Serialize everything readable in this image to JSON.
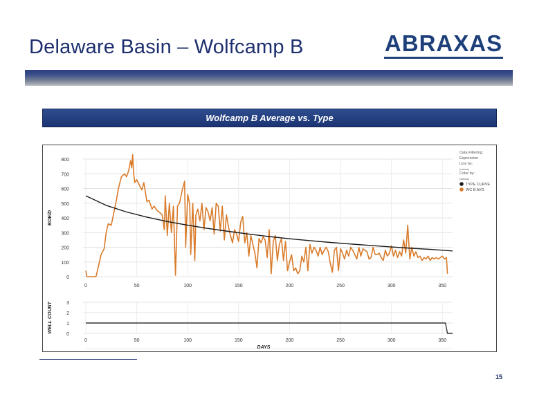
{
  "slide": {
    "title": "Delaware Basin – Wolfcamp B",
    "logo_text": "ABRAXAS",
    "page_number": "15",
    "colors": {
      "brand": "#1d2f6e",
      "band": "#2a3f7e"
    }
  },
  "chart_banner": "Wolfcamp B Average vs. Type",
  "chart_data": [
    {
      "type": "line",
      "title": "",
      "xlabel": "",
      "ylabel": "BOE/D",
      "xlim": [
        0,
        360
      ],
      "ylim": [
        0,
        800
      ],
      "x_ticks": [
        0,
        50,
        100,
        150,
        200,
        250,
        300,
        350
      ],
      "y_ticks": [
        0,
        100,
        200,
        300,
        400,
        500,
        600,
        700,
        800
      ],
      "grid": true,
      "legend": {
        "placement": "right",
        "header_lines": [
          "Data Filtering:",
          "Expression",
          "Line by:",
          "(various)",
          "Color by:",
          "(various)"
        ]
      },
      "series": [
        {
          "name": "TYPE CURVE",
          "color": "#1a1a1a",
          "x": [
            0,
            20,
            40,
            60,
            80,
            100,
            120,
            140,
            160,
            180,
            200,
            220,
            240,
            260,
            280,
            300,
            320,
            340,
            360
          ],
          "y": [
            550,
            485,
            440,
            405,
            375,
            350,
            328,
            308,
            290,
            273,
            258,
            245,
            233,
            222,
            212,
            202,
            193,
            185,
            175
          ]
        },
        {
          "name": "WC B AVG",
          "color": "#d97b2a",
          "x": [
            0,
            1,
            5,
            10,
            12,
            15,
            18,
            20,
            22,
            25,
            27,
            30,
            32,
            35,
            38,
            40,
            42,
            44,
            45,
            46,
            47,
            48,
            50,
            52,
            55,
            57,
            60,
            62,
            65,
            67,
            70,
            72,
            75,
            77,
            78,
            80,
            82,
            84,
            86,
            88,
            90,
            92,
            95,
            97,
            98,
            100,
            102,
            103,
            105,
            107,
            108,
            110,
            112,
            114,
            116,
            118,
            120,
            122,
            124,
            126,
            128,
            130,
            132,
            134,
            136,
            138,
            140,
            142,
            144,
            146,
            148,
            150,
            152,
            154,
            156,
            158,
            160,
            162,
            164,
            166,
            168,
            170,
            172,
            174,
            176,
            178,
            180,
            182,
            184,
            186,
            188,
            190,
            192,
            194,
            196,
            198,
            200,
            202,
            204,
            206,
            208,
            210,
            212,
            214,
            216,
            218,
            220,
            222,
            224,
            226,
            228,
            230,
            232,
            234,
            236,
            238,
            240,
            242,
            244,
            246,
            248,
            250,
            252,
            254,
            256,
            258,
            260,
            262,
            264,
            266,
            268,
            270,
            272,
            274,
            276,
            278,
            280,
            282,
            284,
            286,
            288,
            290,
            292,
            294,
            296,
            298,
            300,
            302,
            304,
            306,
            308,
            310,
            312,
            314,
            316,
            318,
            320,
            322,
            324,
            326,
            328,
            330,
            332,
            334,
            336,
            338,
            340,
            342,
            344,
            346,
            348,
            350,
            352,
            354,
            355
          ],
          "y": [
            40,
            0,
            0,
            0,
            60,
            150,
            190,
            300,
            360,
            350,
            420,
            520,
            600,
            680,
            700,
            680,
            720,
            790,
            740,
            830,
            700,
            640,
            660,
            630,
            590,
            640,
            510,
            520,
            460,
            480,
            450,
            440,
            420,
            320,
            550,
            280,
            500,
            300,
            480,
            10,
            480,
            500,
            600,
            650,
            200,
            560,
            490,
            150,
            500,
            110,
            420,
            460,
            380,
            500,
            320,
            470,
            440,
            380,
            470,
            290,
            500,
            480,
            310,
            480,
            250,
            420,
            340,
            280,
            230,
            320,
            290,
            240,
            370,
            410,
            230,
            300,
            140,
            280,
            220,
            160,
            60,
            260,
            230,
            270,
            250,
            130,
            320,
            20,
            240,
            280,
            110,
            220,
            260,
            110,
            240,
            40,
            100,
            150,
            40,
            60,
            20,
            40,
            140,
            100,
            200,
            40,
            220,
            160,
            200,
            180,
            140,
            200,
            150,
            180,
            200,
            170,
            90,
            30,
            180,
            200,
            40,
            190,
            160,
            120,
            180,
            140,
            200,
            180,
            150,
            120,
            200,
            140,
            190,
            180,
            170,
            120,
            130,
            200,
            150,
            150,
            160,
            130,
            110,
            180,
            140,
            160,
            210,
            140,
            180,
            130,
            170,
            140,
            250,
            160,
            350,
            120,
            200,
            140,
            170,
            130,
            140,
            110,
            130,
            120,
            140,
            110,
            130,
            120,
            130,
            120,
            130,
            140,
            120,
            130,
            20
          ]
        }
      ]
    },
    {
      "type": "line",
      "title": "",
      "xlabel": "DAYS",
      "ylabel": "WELL COUNT",
      "xlim": [
        0,
        360
      ],
      "ylim": [
        0,
        3
      ],
      "x_ticks": [
        0,
        50,
        100,
        150,
        200,
        250,
        300,
        350
      ],
      "y_ticks": [
        0,
        1,
        2,
        3
      ],
      "grid": true,
      "series": [
        {
          "name": "",
          "color": "#333333",
          "x": [
            0,
            353,
            355,
            360
          ],
          "y": [
            1,
            1,
            0,
            0
          ]
        }
      ]
    }
  ]
}
